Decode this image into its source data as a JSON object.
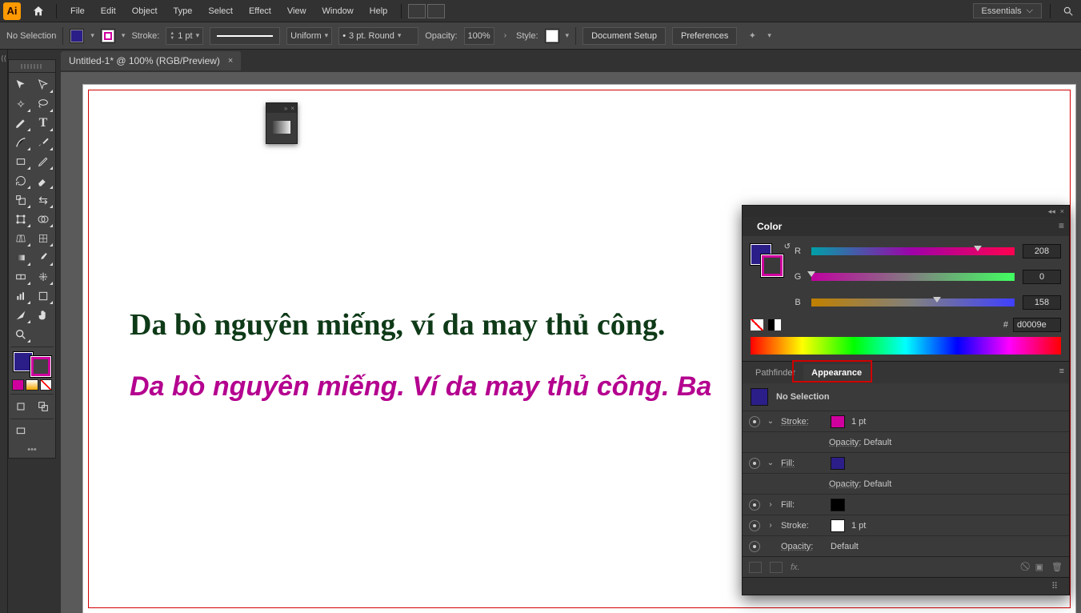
{
  "menu": {
    "items": [
      "File",
      "Edit",
      "Object",
      "Type",
      "Select",
      "Effect",
      "View",
      "Window",
      "Help"
    ],
    "workspace": "Essentials"
  },
  "control": {
    "selection": "No Selection",
    "stroke_label": "Stroke:",
    "stroke_weight": "1 pt",
    "profile": "Uniform",
    "brush_label": "3 pt. Round",
    "opacity_label": "Opacity:",
    "opacity_value": "100%",
    "style_label": "Style:",
    "doc_setup": "Document Setup",
    "preferences": "Preferences"
  },
  "tab": {
    "title": "Untitled-1* @ 100% (RGB/Preview)"
  },
  "canvas": {
    "text1": "Da bò nguyên miếng, ví da may thủ công.",
    "text2": "Da bò nguyên miếng. Ví da may thủ công. Ba"
  },
  "color_panel": {
    "title": "Color",
    "channels": [
      {
        "ch": "R",
        "value": "208",
        "knob": 0.82
      },
      {
        "ch": "G",
        "value": "0",
        "knob": 0.0
      },
      {
        "ch": "B",
        "value": "158",
        "knob": 0.62
      }
    ],
    "hex_label": "#",
    "hex": "d0009e"
  },
  "tabs2": {
    "pathfinder": "Pathfinder",
    "appearance": "Appearance"
  },
  "appearance": {
    "title": "No Selection",
    "rows": [
      {
        "type": "stroke",
        "label": "Stroke:",
        "swatch": "#d0009e",
        "value": "1 pt",
        "caret": "⌄"
      },
      {
        "type": "opacity",
        "label": "Opacity:",
        "value": "Default",
        "sub": true
      },
      {
        "type": "fill",
        "label": "Fill:",
        "swatch": "#2b1e88",
        "value": "",
        "caret": "⌄"
      },
      {
        "type": "opacity",
        "label": "Opacity:",
        "value": "Default",
        "sub": true
      },
      {
        "type": "fill",
        "label": "Fill:",
        "swatch": "#000000",
        "value": "",
        "caret": "›"
      },
      {
        "type": "stroke",
        "label": "Stroke:",
        "swatch": "#ffffff",
        "value": "1 pt",
        "caret": "›"
      },
      {
        "type": "opacity",
        "label": "Opacity:",
        "value": "Default",
        "sub": true
      }
    ],
    "fx": "fx."
  }
}
